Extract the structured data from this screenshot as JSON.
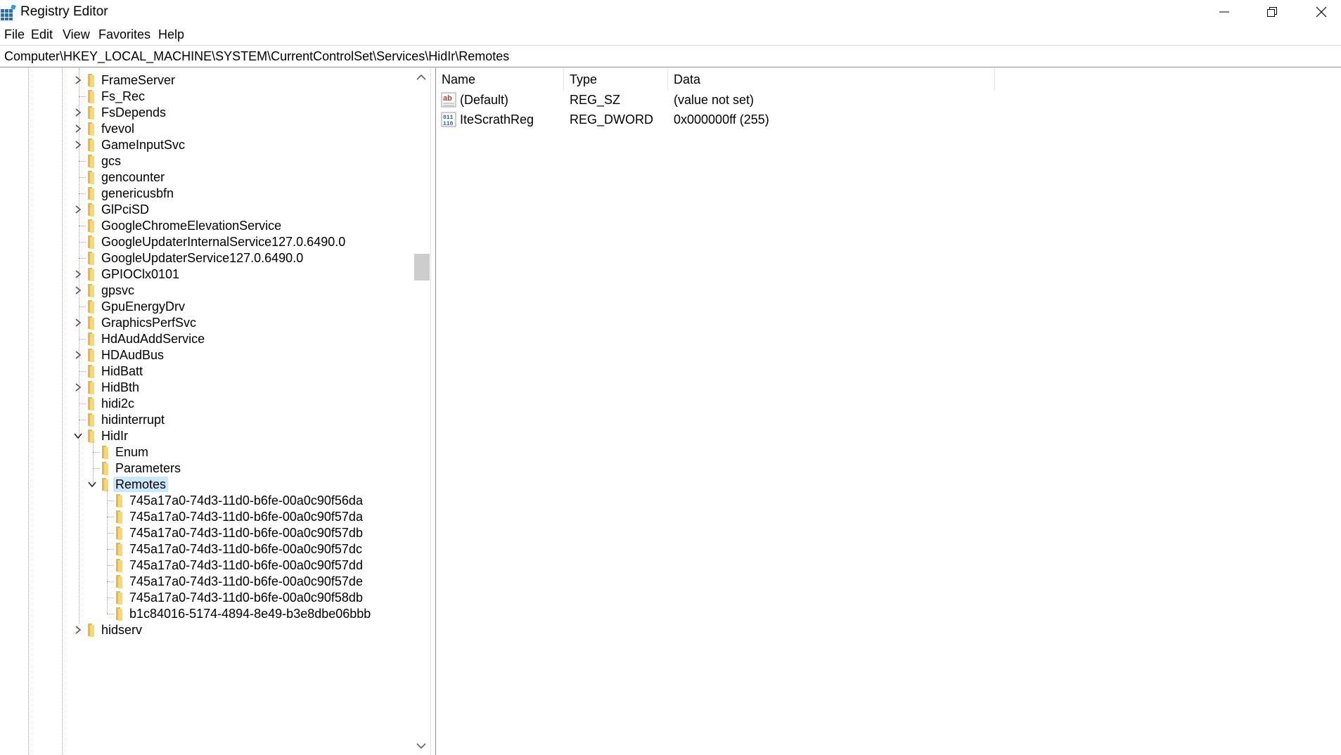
{
  "window": {
    "title": "Registry Editor",
    "controls": {
      "minimize": "minimize",
      "restore": "restore",
      "close": "close"
    }
  },
  "menu": [
    "File",
    "Edit",
    "View",
    "Favorites",
    "Help"
  ],
  "address": "Computer\\HKEY_LOCAL_MACHINE\\SYSTEM\\CurrentControlSet\\Services\\HidIr\\Remotes",
  "tree": {
    "nodes": [
      {
        "label": "FrameServer",
        "level": 0,
        "expander": "collapsed"
      },
      {
        "label": "Fs_Rec",
        "level": 0,
        "expander": "none"
      },
      {
        "label": "FsDepends",
        "level": 0,
        "expander": "collapsed"
      },
      {
        "label": "fvevol",
        "level": 0,
        "expander": "collapsed"
      },
      {
        "label": "GameInputSvc",
        "level": 0,
        "expander": "collapsed"
      },
      {
        "label": "gcs",
        "level": 0,
        "expander": "none"
      },
      {
        "label": "gencounter",
        "level": 0,
        "expander": "none"
      },
      {
        "label": "genericusbfn",
        "level": 0,
        "expander": "none"
      },
      {
        "label": "GlPciSD",
        "level": 0,
        "expander": "collapsed"
      },
      {
        "label": "GoogleChromeElevationService",
        "level": 0,
        "expander": "none"
      },
      {
        "label": "GoogleUpdaterInternalService127.0.6490.0",
        "level": 0,
        "expander": "none"
      },
      {
        "label": "GoogleUpdaterService127.0.6490.0",
        "level": 0,
        "expander": "none"
      },
      {
        "label": "GPIOClx0101",
        "level": 0,
        "expander": "collapsed"
      },
      {
        "label": "gpsvc",
        "level": 0,
        "expander": "collapsed"
      },
      {
        "label": "GpuEnergyDrv",
        "level": 0,
        "expander": "none"
      },
      {
        "label": "GraphicsPerfSvc",
        "level": 0,
        "expander": "collapsed"
      },
      {
        "label": "HdAudAddService",
        "level": 0,
        "expander": "none"
      },
      {
        "label": "HDAudBus",
        "level": 0,
        "expander": "collapsed"
      },
      {
        "label": "HidBatt",
        "level": 0,
        "expander": "none"
      },
      {
        "label": "HidBth",
        "level": 0,
        "expander": "collapsed"
      },
      {
        "label": "hidi2c",
        "level": 0,
        "expander": "none"
      },
      {
        "label": "hidinterrupt",
        "level": 0,
        "expander": "none"
      },
      {
        "label": "HidIr",
        "level": 0,
        "expander": "expanded"
      },
      {
        "label": "Enum",
        "level": 1,
        "expander": "none"
      },
      {
        "label": "Parameters",
        "level": 1,
        "expander": "none"
      },
      {
        "label": "Remotes",
        "level": 1,
        "expander": "expanded",
        "selected": true
      },
      {
        "label": "745a17a0-74d3-11d0-b6fe-00a0c90f56da",
        "level": 2,
        "expander": "none"
      },
      {
        "label": "745a17a0-74d3-11d0-b6fe-00a0c90f57da",
        "level": 2,
        "expander": "none"
      },
      {
        "label": "745a17a0-74d3-11d0-b6fe-00a0c90f57db",
        "level": 2,
        "expander": "none"
      },
      {
        "label": "745a17a0-74d3-11d0-b6fe-00a0c90f57dc",
        "level": 2,
        "expander": "none"
      },
      {
        "label": "745a17a0-74d3-11d0-b6fe-00a0c90f57dd",
        "level": 2,
        "expander": "none"
      },
      {
        "label": "745a17a0-74d3-11d0-b6fe-00a0c90f57de",
        "level": 2,
        "expander": "none"
      },
      {
        "label": "745a17a0-74d3-11d0-b6fe-00a0c90f58db",
        "level": 2,
        "expander": "none"
      },
      {
        "label": "b1c84016-5174-4894-8e49-b3e8dbe06bbb",
        "level": 2,
        "expander": "none"
      },
      {
        "label": "hidserv",
        "level": 0,
        "expander": "collapsed"
      }
    ]
  },
  "list": {
    "columns": [
      "Name",
      "Type",
      "Data"
    ],
    "rows": [
      {
        "icon": "string-value-icon",
        "name": "(Default)",
        "type": "REG_SZ",
        "data": "(value not set)"
      },
      {
        "icon": "binary-value-icon",
        "name": "IteScrathReg",
        "type": "REG_DWORD",
        "data": "0x000000ff (255)"
      }
    ]
  },
  "colors": {
    "selection": "#cce8ff",
    "folder": "#f8d775",
    "folder_dark": "#e6b84a"
  }
}
